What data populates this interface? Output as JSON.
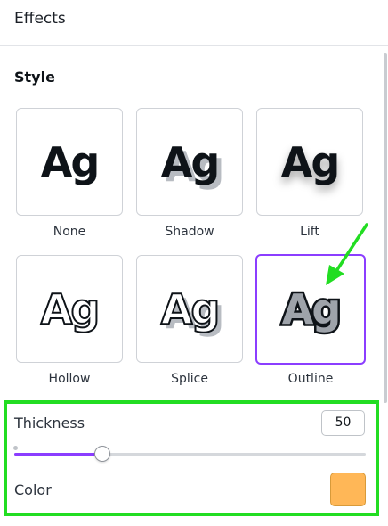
{
  "header": {
    "title": "Effects"
  },
  "style_section": {
    "title": "Style",
    "options": [
      {
        "label": "None",
        "sample": "Ag"
      },
      {
        "label": "Shadow",
        "sample": "Ag"
      },
      {
        "label": "Lift",
        "sample": "Ag"
      },
      {
        "label": "Hollow",
        "sample": "Ag"
      },
      {
        "label": "Splice",
        "sample": "Ag"
      },
      {
        "label": "Outline",
        "sample": "Ag"
      }
    ],
    "selected": "Outline"
  },
  "controls": {
    "thickness": {
      "label": "Thickness",
      "value": "50",
      "slider_fraction": 0.25
    },
    "color": {
      "label": "Color",
      "swatch_color": "#ffb757"
    }
  },
  "colors": {
    "accent": "#8b3dff",
    "annotation": "#22dd22"
  },
  "icons": {
    "annotation_arrow": "arrow-icon"
  }
}
